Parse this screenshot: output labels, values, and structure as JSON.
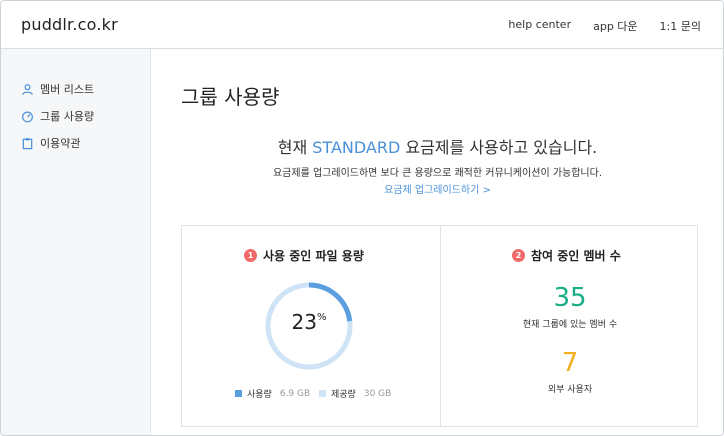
{
  "header": {
    "logo": "puddlr.co.kr",
    "nav": [
      "help center",
      "app 다운",
      "1:1 문의"
    ]
  },
  "sidebar": {
    "items": [
      {
        "label": "멤버 리스트",
        "icon": "user-icon"
      },
      {
        "label": "그룹 사용량",
        "icon": "gauge-icon"
      },
      {
        "label": "이용약관",
        "icon": "clipboard-icon"
      }
    ]
  },
  "main": {
    "title": "그룹 사용량",
    "plan_prefix": "현재 ",
    "plan_name": "STANDARD",
    "plan_suffix": " 요금제를 사용하고 있습니다.",
    "plan_desc": "요금제를 업그레이드하면 보다 큰 용량으로 쾌적한 커뮤니케이션이 가능합니다.",
    "upgrade_link": "요금제 업그레이드하기 >"
  },
  "storage": {
    "badge": "1",
    "title": "사용 중인 파일 용량",
    "percent": 23,
    "percent_text": "23",
    "percent_unit": "%",
    "used_label": "사용량",
    "used_value": "6.9 GB",
    "total_label": "제공량",
    "total_value": "30 GB"
  },
  "members": {
    "badge": "2",
    "title": "참여 중인 멤버 수",
    "internal_count": "35",
    "internal_label": "현재 그룹에 있는 멤버 수",
    "external_count": "7",
    "external_label": "외부 사용자"
  },
  "colors": {
    "accent": "#4a90d9",
    "gauge_fill": "#5b9fe0",
    "gauge_track": "#cfe3f6",
    "badge": "#f06a6a",
    "internal": "#1aae86",
    "external": "#f2b01e"
  }
}
